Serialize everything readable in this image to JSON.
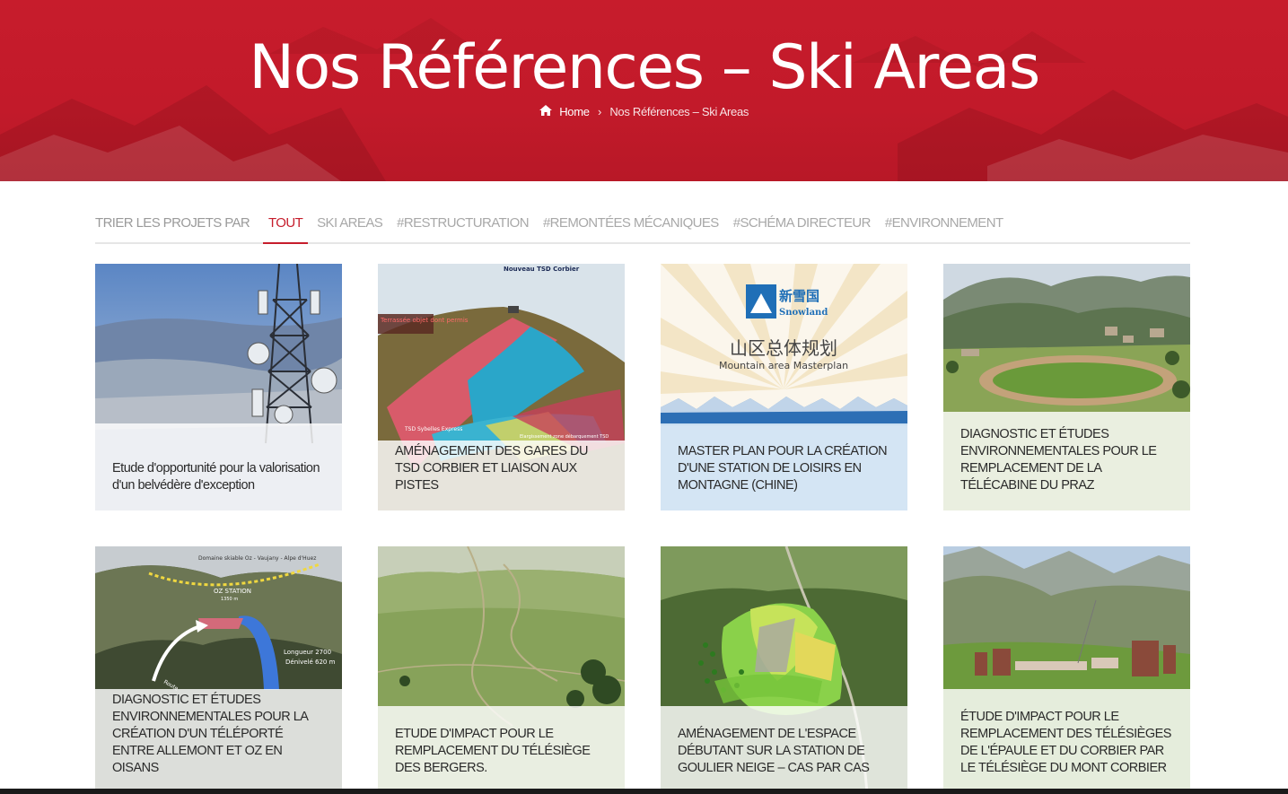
{
  "hero": {
    "title": "Nos Références – Ski Areas",
    "breadcrumb": {
      "home": "Home",
      "current": "Nos Références – Ski Areas",
      "separator": "›"
    },
    "color": "#c71c2c"
  },
  "filters": {
    "label": "TRIER LES PROJETS PAR",
    "tabs": [
      "TOUT",
      "SKI AREAS",
      "#RESTRUCTURATION",
      "#REMONTÉES MÉCANIQUES",
      "#SCHÉMA DIRECTEUR",
      "#ENVIRONNEMENT"
    ],
    "active": "TOUT",
    "accent": "#c61d2c"
  },
  "projects": [
    {
      "title": "Etude d'opportunité pour la valorisation d'un belvédère d'exception"
    },
    {
      "title": "AMÉNAGEMENT DES GARES DU TSD CORBIER ET LIAISON AUX PISTES"
    },
    {
      "title": "MASTER PLAN POUR LA CRÉATION D'UNE STATION DE LOISIRS EN MONTAGNE (CHINE)"
    },
    {
      "title": "DIAGNOSTIC ET ÉTUDES ENVIRONNEMENTALES POUR LE REMPLACEMENT DE LA TÉLÉCABINE DU PRAZ"
    },
    {
      "title": "DIAGNOSTIC ET ÉTUDES ENVIRONNEMENTALES POUR LA CRÉATION D'UN TÉLÉPORTÉ ENTRE ALLEMONT ET OZ EN OISANS"
    },
    {
      "title": "ETUDE D'IMPACT POUR LE REMPLACEMENT DU TÉLÉSIÈGE DES BERGERS."
    },
    {
      "title": "AMÉNAGEMENT DE L'ESPACE DÉBUTANT SUR LA STATION DE GOULIER NEIGE – CAS PAR CAS"
    },
    {
      "title": "ÉTUDE D'IMPACT POUR LE REMPLACEMENT DES TÉLÉSIÈGES DE L'ÉPAULE ET DU CORBIER PAR LE TÉLÉSIÈGE DU MONT CORBIER"
    }
  ],
  "image_text": {
    "corbier_top": "Nouveau TSD Corbier",
    "corbier_box": "Terrassée objet dont permis",
    "corbier_bottom": "TSD Sybelles Express",
    "corbier_bottom2": "Elargissement zone débarquement TSD",
    "snowland_cn": "新雪国",
    "snowland_en": "Snowland",
    "masterplan_cn": "山区总体规划",
    "masterplan_en": "Mountain area Masterplan",
    "oz_domain": "Domaine skiable Oz - Vaujany - Alpe d'Huez",
    "oz_station": "OZ STATION",
    "oz_alt": "1350 m",
    "oz_length": "Longueur 2700",
    "oz_denivele": "Dénivelé 620 m",
    "oz_route": "Route"
  }
}
